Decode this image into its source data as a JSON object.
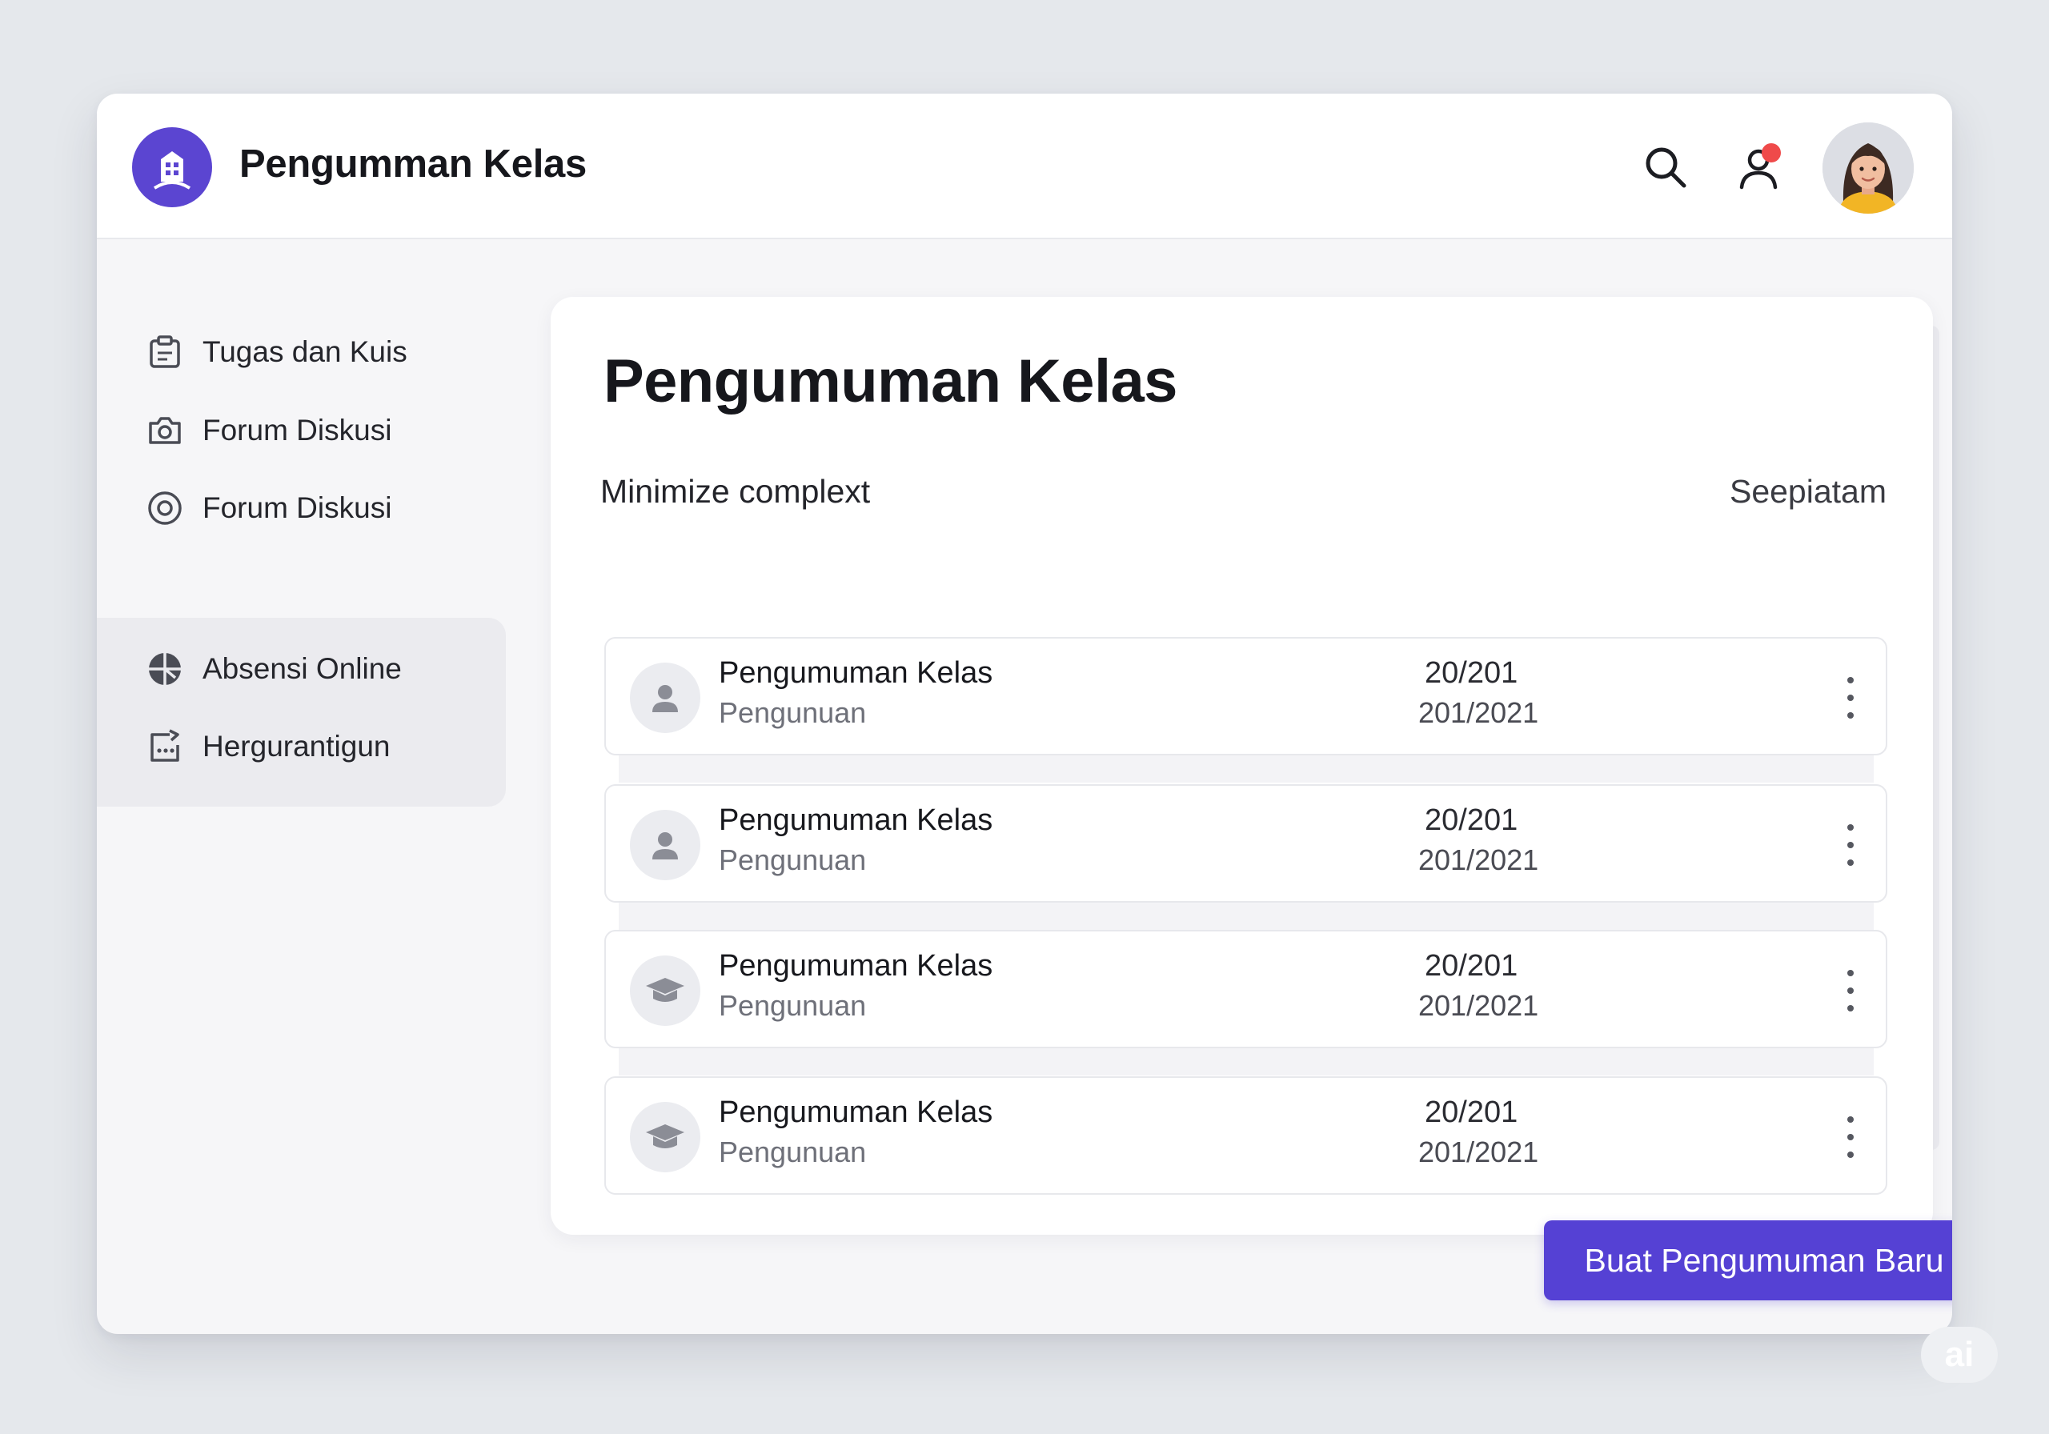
{
  "header": {
    "title": "Pengumman Kelas",
    "icons": [
      "building-logo-icon",
      "search-icon",
      "user-notification-icon",
      "user-avatar"
    ]
  },
  "sidebar": {
    "items": [
      {
        "label": "Tugas dan Kuis",
        "icon": "clipboard-icon"
      },
      {
        "label": "Forum Diskusi",
        "icon": "camera-icon"
      },
      {
        "label": "Forum Diskusi",
        "icon": "target-icon"
      }
    ],
    "group": [
      {
        "label": "Absensi Online",
        "icon": "globe-icon"
      },
      {
        "label": "Hergurantigun",
        "icon": "calendar-share-icon"
      }
    ]
  },
  "main": {
    "title": "Pengumuman Kelas",
    "subheader_left": "Minimize complext",
    "subheader_right": "Seepiatam",
    "announcements": [
      {
        "title": "Pengumuman Kelas",
        "subtitle": "Pengunuan",
        "date1": "20/201",
        "date2": "201/2021",
        "icon": "person-icon"
      },
      {
        "title": "Pengumuman Kelas",
        "subtitle": "Pengunuan",
        "date1": "20/201",
        "date2": "201/2021",
        "icon": "person-icon"
      },
      {
        "title": "Pengumuman Kelas",
        "subtitle": "Pengunuan",
        "date1": "20/201",
        "date2": "201/2021",
        "icon": "graduation-cap-icon"
      },
      {
        "title": "Pengumuman Kelas",
        "subtitle": "Pengunuan",
        "date1": "20/201",
        "date2": "201/2021",
        "icon": "graduation-cap-icon"
      }
    ],
    "cta_label": "Buat Pengumuman Baru"
  },
  "watermark": "ai",
  "colors": {
    "accent": "#5541d4",
    "notification": "#ef4a4a",
    "background": "#e5e8ec"
  }
}
